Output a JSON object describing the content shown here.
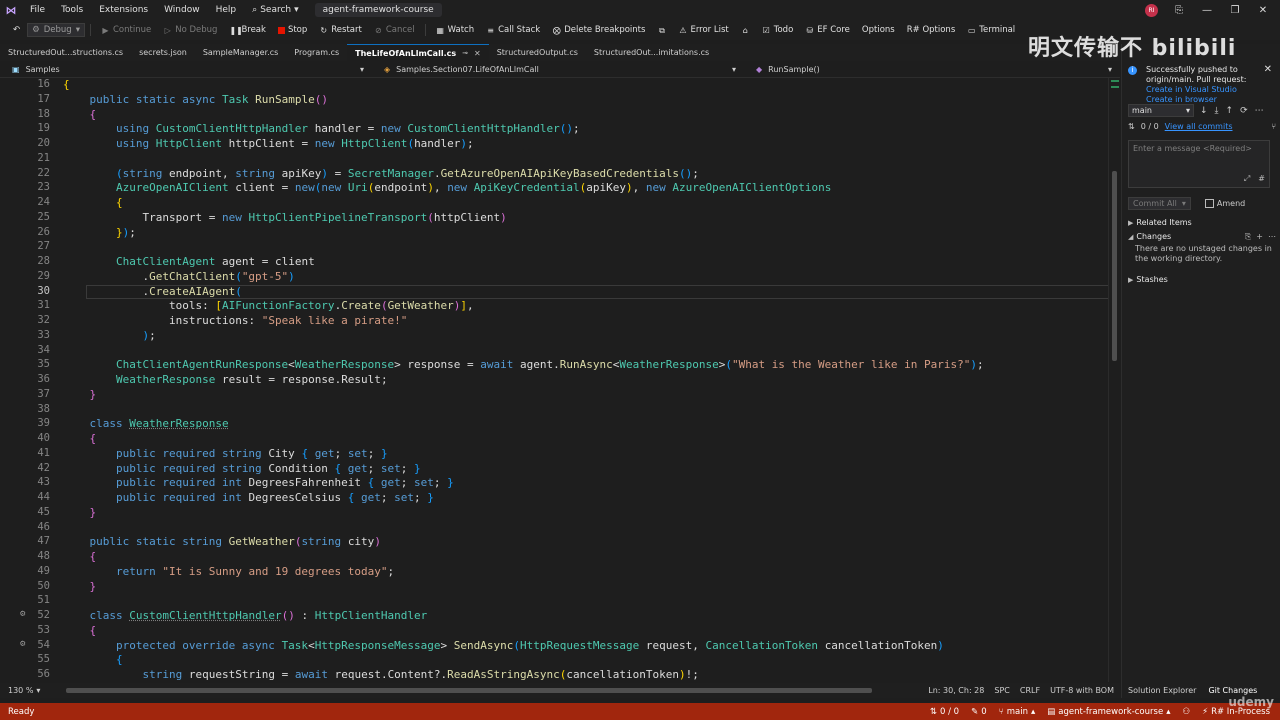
{
  "menubar": {
    "items": [
      "File",
      "Tools",
      "Extensions",
      "Window",
      "Help"
    ],
    "search_label": "Search",
    "solution_name": "agent-framework-course",
    "avatar_initials": "RI"
  },
  "toolbar": {
    "config": "Debug",
    "continue": "Continue",
    "no_debug": "No Debug",
    "break": "Break",
    "stop": "Stop",
    "restart": "Restart",
    "cancel": "Cancel",
    "watch": "Watch",
    "call_stack": "Call Stack",
    "delete_breakpoints": "Delete Breakpoints",
    "error_list": "Error List",
    "todo": "Todo",
    "ef_core": "EF Core",
    "options": "Options",
    "r_options": "R# Options",
    "terminal": "Terminal"
  },
  "tabs": [
    {
      "label": "StructuredOut...structions.cs",
      "active": false
    },
    {
      "label": "secrets.json",
      "active": false
    },
    {
      "label": "SampleManager.cs",
      "active": false
    },
    {
      "label": "Program.cs",
      "active": false
    },
    {
      "label": "TheLifeOfAnLlmCall.cs",
      "active": true
    },
    {
      "label": "StructuredOutput.cs",
      "active": false
    },
    {
      "label": "StructuredOut...imitations.cs",
      "active": false
    }
  ],
  "navbar": {
    "project": "Samples",
    "class_path": "Samples.Section07.LifeOfAnLlmCall",
    "member": "RunSample()"
  },
  "editor": {
    "current_line": 30,
    "lines": [
      {
        "n": "16",
        "html": "<span class=\"br\">{</span>"
      },
      {
        "n": "17",
        "html": "    <span class=\"kw\">public static async</span> <span class=\"ty\">Task</span> <span class=\"me\">RunSample</span><span class=\"br2\">()</span>"
      },
      {
        "n": "18",
        "html": "    <span class=\"br2\">{</span>"
      },
      {
        "n": "19",
        "html": "        <span class=\"kw\">using</span> <span class=\"ty\">CustomClientHttpHandler</span> <span class=\"id\">handler</span> = <span class=\"kw\">new</span> <span class=\"ty\">CustomClientHttpHandler</span><span class=\"br3\">()</span>;"
      },
      {
        "n": "20",
        "html": "        <span class=\"kw\">using</span> <span class=\"ty\">HttpClient</span> <span class=\"id\">httpClient</span> = <span class=\"kw\">new</span> <span class=\"ty\">HttpClient</span><span class=\"br3\">(</span><span class=\"id\">handler</span><span class=\"br3\">)</span>;"
      },
      {
        "n": "21",
        "html": ""
      },
      {
        "n": "22",
        "html": "        <span class=\"br3\">(</span><span class=\"kw\">string</span> <span class=\"id\">endpoint</span>, <span class=\"kw\">string</span> <span class=\"id\">apiKey</span><span class=\"br3\">)</span> = <span class=\"ty\">SecretManager</span>.<span class=\"me\">GetAzureOpenAIApiKeyBasedCredentials</span><span class=\"br3\">()</span>;"
      },
      {
        "n": "23",
        "html": "        <span class=\"ty\">AzureOpenAIClient</span> <span class=\"id\">client</span> = <span class=\"kw\">new</span><span class=\"br3\">(</span><span class=\"kw\">new</span> <span class=\"ty\">Uri</span><span class=\"br\">(</span><span class=\"id\">endpoint</span><span class=\"br\">)</span>, <span class=\"kw\">new</span> <span class=\"ty\">ApiKeyCredential</span><span class=\"br\">(</span><span class=\"id\">apiKey</span><span class=\"br\">)</span>, <span class=\"kw\">new</span> <span class=\"ty\">AzureOpenAIClientOptions</span>"
      },
      {
        "n": "24",
        "html": "        <span class=\"br\">{</span>"
      },
      {
        "n": "25",
        "html": "            <span class=\"id\">Transport</span> = <span class=\"kw\">new</span> <span class=\"ty\">HttpClientPipelineTransport</span><span class=\"br2\">(</span><span class=\"id\">httpClient</span><span class=\"br2\">)</span>"
      },
      {
        "n": "26",
        "html": "        <span class=\"br\">}</span><span class=\"br3\">)</span>;"
      },
      {
        "n": "27",
        "html": ""
      },
      {
        "n": "28",
        "html": "        <span class=\"ty\">ChatClientAgent</span> <span class=\"id\">agent</span> = <span class=\"id\">client</span>"
      },
      {
        "n": "29",
        "html": "            .<span class=\"me\">GetChatClient</span><span class=\"br3\">(</span><span class=\"st\">\"gpt-5\"</span><span class=\"br3\">)</span>"
      },
      {
        "n": "30",
        "html": "            .<span class=\"me\">CreateAIAgent</span><span class=\"br3\">(</span>"
      },
      {
        "n": "31",
        "html": "                <span class=\"id\">tools</span>: <span class=\"br\">[</span><span class=\"ty\">AIFunctionFactory</span>.<span class=\"me\">Create</span><span class=\"br2\">(</span><span class=\"me\">GetWeather</span><span class=\"br2\">)</span><span class=\"br\">]</span>,"
      },
      {
        "n": "32",
        "html": "                <span class=\"id\">instructions</span>: <span class=\"st\">\"Speak like a pirate!\"</span>"
      },
      {
        "n": "33",
        "html": "            <span class=\"br3\">)</span>;"
      },
      {
        "n": "34",
        "html": ""
      },
      {
        "n": "35",
        "html": "        <span class=\"ty\">ChatClientAgentRunResponse</span>&lt;<span class=\"ty\">WeatherResponse</span>&gt; <span class=\"id\">response</span> = <span class=\"kw\">await</span> <span class=\"id\">agent</span>.<span class=\"me\">RunAsync</span>&lt;<span class=\"ty\">WeatherResponse</span>&gt;<span class=\"br3\">(</span><span class=\"st\">\"What is the Weather like in Paris?\"</span><span class=\"br3\">)</span>;"
      },
      {
        "n": "36",
        "html": "        <span class=\"ty\">WeatherResponse</span> <span class=\"id\">result</span> = <span class=\"id\">response</span>.<span class=\"id\">Result</span>;"
      },
      {
        "n": "37",
        "html": "    <span class=\"br2\">}</span>"
      },
      {
        "n": "38",
        "html": ""
      },
      {
        "n": "39",
        "html": "    <span class=\"kw\">class</span> <span class=\"ty ul\">WeatherResponse</span>"
      },
      {
        "n": "40",
        "html": "    <span class=\"br2\">{</span>"
      },
      {
        "n": "41",
        "html": "        <span class=\"kw\">public required string</span> <span class=\"id\">City</span> <span class=\"br3\">{</span> <span class=\"kw\">get</span>; <span class=\"kw\">set</span>; <span class=\"br3\">}</span>"
      },
      {
        "n": "42",
        "html": "        <span class=\"kw\">public required string</span> <span class=\"id\">Condition</span> <span class=\"br3\">{</span> <span class=\"kw\">get</span>; <span class=\"kw\">set</span>; <span class=\"br3\">}</span>"
      },
      {
        "n": "43",
        "html": "        <span class=\"kw\">public required int</span> <span class=\"id\">DegreesFahrenheit</span> <span class=\"br3\">{</span> <span class=\"kw\">get</span>; <span class=\"kw\">set</span>; <span class=\"br3\">}</span>"
      },
      {
        "n": "44",
        "html": "        <span class=\"kw\">public required int</span> <span class=\"id\">DegreesCelsius</span> <span class=\"br3\">{</span> <span class=\"kw\">get</span>; <span class=\"kw\">set</span>; <span class=\"br3\">}</span>"
      },
      {
        "n": "45",
        "html": "    <span class=\"br2\">}</span>"
      },
      {
        "n": "46",
        "html": ""
      },
      {
        "n": "47",
        "html": "    <span class=\"kw\">public static string</span> <span class=\"me\">GetWeather</span><span class=\"br2\">(</span><span class=\"kw\">string</span> <span class=\"id\">city</span><span class=\"br2\">)</span>"
      },
      {
        "n": "48",
        "html": "    <span class=\"br2\">{</span>"
      },
      {
        "n": "49",
        "html": "        <span class=\"kw\">return</span> <span class=\"st\">\"It is Sunny and 19 degrees today\"</span>;"
      },
      {
        "n": "50",
        "html": "    <span class=\"br2\">}</span>"
      },
      {
        "n": "51",
        "html": ""
      },
      {
        "n": "52",
        "html": "    <span class=\"kw\">class</span> <span class=\"ty ul\">CustomClientHttpHandler</span><span class=\"br2\">()</span> : <span class=\"ty\">HttpClientHandler</span>",
        "gutter": true
      },
      {
        "n": "53",
        "html": "    <span class=\"br2\">{</span>"
      },
      {
        "n": "54",
        "html": "        <span class=\"kw\">protected override async</span> <span class=\"ty\">Task</span>&lt;<span class=\"ty\">HttpResponseMessage</span>&gt; <span class=\"me\">SendAsync</span><span class=\"br3\">(</span><span class=\"ty\">HttpRequestMessage</span> <span class=\"id\">request</span>, <span class=\"ty\">CancellationToken</span> <span class=\"id\">cancellationToken</span><span class=\"br3\">)</span>",
        "gutter": true
      },
      {
        "n": "55",
        "html": "        <span class=\"br3\">{</span>"
      },
      {
        "n": "56",
        "html": "            <span class=\"kw\">string</span> <span class=\"id\">requestString</span> = <span class=\"kw\">await</span> <span class=\"id\">request</span>.<span class=\"id\">Content</span>?.<span class=\"me\">ReadAsStringAsync</span><span class=\"br\">(</span><span class=\"id\">cancellationToken</span><span class=\"br\">)</span>!;"
      }
    ]
  },
  "editor_status": {
    "zoom": "130 %",
    "position": "Ln: 30, Ch: 28",
    "spc": "SPC",
    "crlf": "CRLF",
    "encoding": "UTF-8 with BOM"
  },
  "git": {
    "watermark": "明文传输不 bilibili",
    "notification": {
      "text": "Successfully pushed to origin/main. Pull request:",
      "link1": "Create in Visual Studio",
      "link2": "Create in browser"
    },
    "branch": "main",
    "commits_count": "0 / 0",
    "view_all": "View all commits",
    "message_placeholder": "Enter a message <Required>",
    "commit_all": "Commit All",
    "amend": "Amend",
    "related_items": "Related Items",
    "changes": "Changes",
    "no_changes": "There are no unstaged changes in the working directory.",
    "stashes": "Stashes",
    "tab_solution": "Solution Explorer",
    "tab_git": "Git Changes"
  },
  "statusbar": {
    "ready": "Ready",
    "sync": "0 / 0",
    "pencil_count": "0",
    "branch": "main",
    "repo": "agent-framework-course",
    "resharper": "R# In-Process"
  },
  "udemy": "udemy",
  "colors": {
    "status_bar": "#a1260d",
    "accent": "#0e70c0",
    "editor_bg": "#1e1e1e"
  }
}
